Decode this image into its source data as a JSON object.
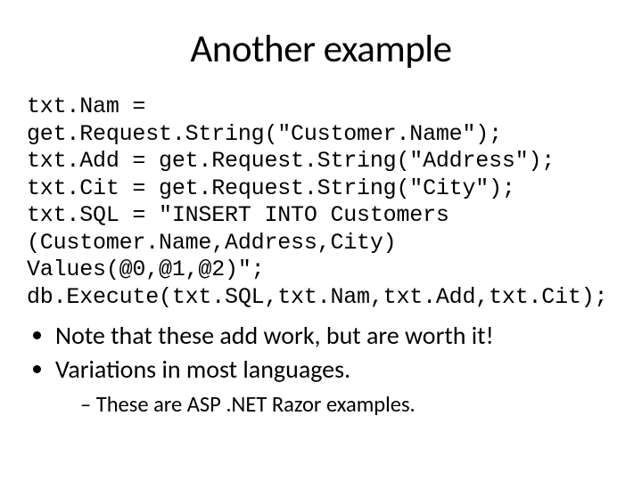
{
  "title": "Another example",
  "code": {
    "l1": "txt.Nam = get.Request.String(\"Customer.Name\");",
    "l2": "txt.Add = get.Request.String(\"Address\");",
    "l3": "txt.Cit = get.Request.String(\"City\");",
    "l4": "txt.SQL = \"INSERT INTO Customers",
    "l5": "(Customer.Name,Address,City) Values(@0,@1,@2)\";",
    "l6": "db.Execute(txt.SQL,txt.Nam,txt.Add,txt.Cit);"
  },
  "bullets": {
    "b1": "Note that these add work, but are worth it!",
    "b2": "Variations in most languages.",
    "sub1": "These are ASP .NET Razor examples."
  }
}
